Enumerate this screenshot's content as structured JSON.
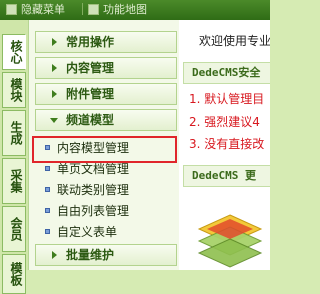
{
  "topbar": {
    "items": [
      {
        "label": "隐藏菜单",
        "icon": "hide-menu-icon"
      },
      {
        "label": "功能地图",
        "icon": "map-icon"
      }
    ]
  },
  "side_tabs": [
    {
      "label": "核心",
      "active": true
    },
    {
      "label": "模块",
      "active": false
    },
    {
      "label": "生成",
      "active": false
    },
    {
      "label": "采集",
      "active": false
    },
    {
      "label": "会员",
      "active": false
    },
    {
      "label": "模板",
      "active": false
    }
  ],
  "menu": {
    "groups": [
      {
        "label": "常用操作",
        "expanded": false
      },
      {
        "label": "内容管理",
        "expanded": false
      },
      {
        "label": "附件管理",
        "expanded": false
      },
      {
        "label": "频道模型",
        "expanded": true
      },
      {
        "label": "批量维护",
        "expanded": false
      }
    ],
    "channel_items": [
      {
        "label": "内容模型管理",
        "selected": true
      },
      {
        "label": "单页文档管理",
        "selected": false
      },
      {
        "label": "联动类别管理",
        "selected": false
      },
      {
        "label": "自由列表管理",
        "selected": false
      },
      {
        "label": "自定义表单",
        "selected": false
      }
    ]
  },
  "content": {
    "welcome": "欢迎使用专业",
    "security_panel_title": "DedeCMS安全",
    "notices": [
      "1. 默认管理目",
      "2. 强烈建议4",
      "3. 没有直接改"
    ],
    "update_panel_title": "DedeCMS 更"
  },
  "colors": {
    "accent_green": "#2f6c16",
    "highlight_red": "#e0262b",
    "notice_red": "#d8181f"
  }
}
